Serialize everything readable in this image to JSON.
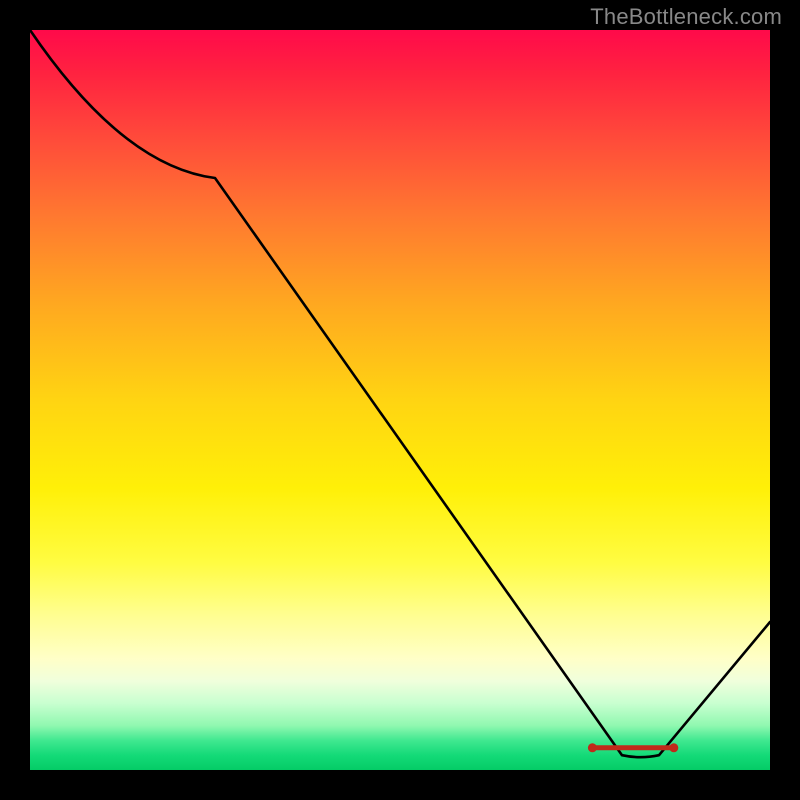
{
  "attribution": "TheBottleneck.com",
  "chart_data": {
    "type": "line",
    "x": [
      0,
      25,
      80,
      85,
      100
    ],
    "values": [
      100,
      80,
      2,
      2,
      20
    ],
    "title": "",
    "xlabel": "",
    "ylabel": "",
    "xlim": [
      0,
      100
    ],
    "ylim": [
      0,
      100
    ],
    "series": [
      {
        "name": "curve",
        "x": [
          0,
          25,
          80,
          85,
          100
        ],
        "y": [
          100,
          80,
          2,
          2,
          20
        ]
      }
    ],
    "gradient_stops": [
      {
        "pct": 0,
        "color": "#ff0a4a"
      },
      {
        "pct": 25,
        "color": "#ff7830"
      },
      {
        "pct": 50,
        "color": "#ffd412"
      },
      {
        "pct": 75,
        "color": "#fffe90"
      },
      {
        "pct": 95,
        "color": "#40e890"
      },
      {
        "pct": 100,
        "color": "#04cc66"
      }
    ],
    "marker": {
      "color": "#c02a1a",
      "x_start": 76,
      "x_end": 87,
      "y": 3
    }
  }
}
